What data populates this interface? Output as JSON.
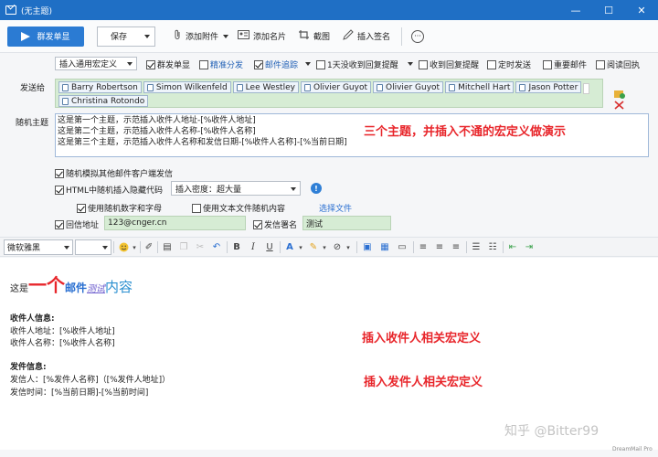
{
  "window": {
    "title": "(无主题)",
    "min_glyph": "—",
    "max_glyph": "☐",
    "close_glyph": "✕"
  },
  "toolbar": {
    "send_label": "群发单显",
    "save_label": "保存",
    "attach_label": "添加附件",
    "card_label": "添加名片",
    "screenshot_label": "截图",
    "signature_label": "插入签名",
    "more_glyph": "···"
  },
  "options": {
    "macro_select": "插入通用宏定义",
    "mass_single": "群发单显",
    "precise": "精准分发",
    "tracking": "邮件追踪",
    "remind": "1天没收到回复提醒",
    "reply_remind": "收到回复提醒",
    "scheduled": "定时发送",
    "important": "重要邮件",
    "read_receipt": "阅读回执"
  },
  "recipients": {
    "label": "发送给",
    "list": [
      "Barry Robertson",
      "Simon Wilkenfeld",
      "Lee Westley",
      "Olivier Guyot",
      "Olivier Guyot",
      "Mitchell Hart",
      "Jason Potter",
      "Christina Rotondo"
    ]
  },
  "subjects": {
    "label": "随机主题",
    "lines": [
      "这是第一个主题，示范插入收件人地址-[%收件人地址]",
      "这是第二个主题，示范插入收件人名称-[%收件人名称]",
      "这是第三个主题，示范插入收件人名称和发信日期-[%收件人名称]-[%当前日期]"
    ],
    "note": "三个主题，并插入不通的宏定义做演示"
  },
  "advanced": {
    "simulate_client": "随机模拟其他邮件客户端发信",
    "html_hidden": "HTML中随机插入隐藏代码",
    "density_select": "插入密度：超大量",
    "random_chars": "使用随机数字和字母",
    "text_file": "使用文本文件随机内容",
    "choose_file": "选择文件",
    "reply_label": "回信地址",
    "reply_value": "123@cnger.cn",
    "sig_label": "发信署名",
    "sig_value": "测试"
  },
  "format": {
    "font": "微软雅黑"
  },
  "body": {
    "h_this": "这是",
    "h_one": "一个",
    "h_mail": "邮件",
    "h_test": "测试",
    "h_content": "内容",
    "recipient_title": "收件人信息:",
    "recipient_addr": "收件人地址：[%收件人地址]",
    "recipient_name": "收件人名称：[%收件人名称]",
    "recipient_note": "插入收件人相关宏定义",
    "sender_title": "发件信息:",
    "sender_name": "发信人：[%发件人名称]（[%发件人地址]）",
    "sender_time": "发信时间：[%当前日期]-[%当前时间]",
    "sender_note": "插入发件人相关宏定义"
  },
  "footer": {
    "watermark": "知乎 @Bitter99",
    "brand": "DreamMail Pro"
  },
  "colors": {
    "titlebar": "#1f6fc5",
    "send_button": "#2b7bd3",
    "field_green": "#d6ecd4",
    "note_red": "#e8262b",
    "heading_blue": "#2a6fd1"
  }
}
